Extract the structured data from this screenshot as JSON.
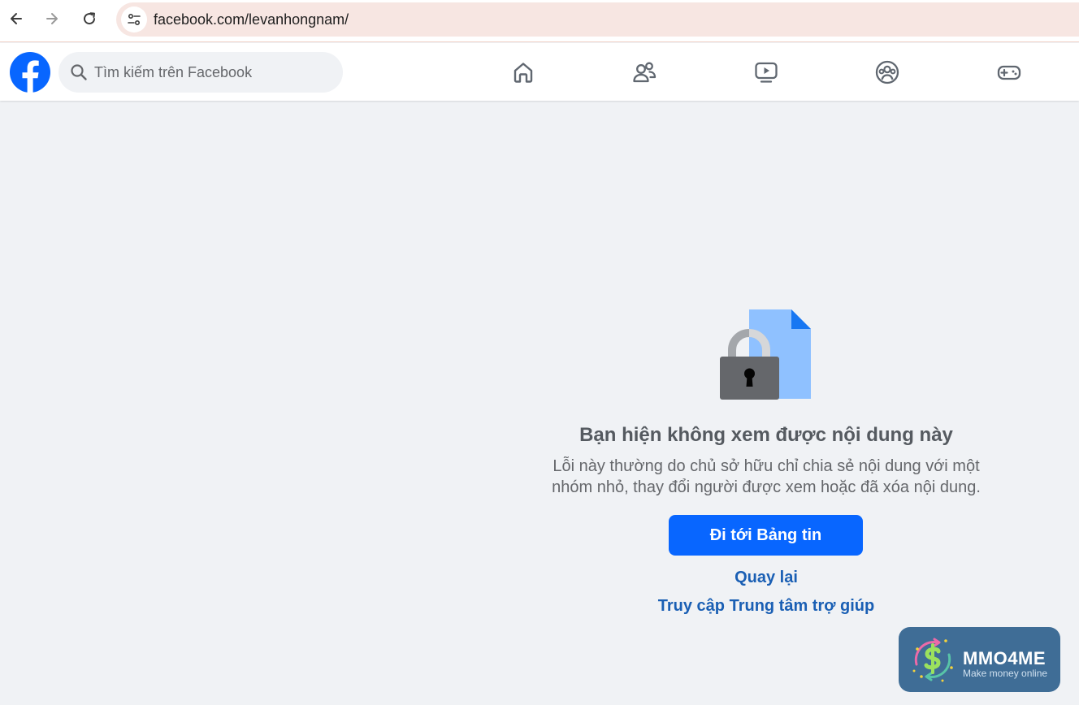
{
  "browser": {
    "url": "facebook.com/levanhongnam/"
  },
  "header": {
    "search_placeholder": "Tìm kiếm trên Facebook",
    "nav_icons": [
      "home-icon",
      "friends-icon",
      "video-icon",
      "groups-icon",
      "gaming-icon"
    ]
  },
  "error": {
    "title": "Bạn hiện không xem được nội dung này",
    "description_line1": "Lỗi này thường do chủ sở hữu chỉ chia sẻ nội dung với một",
    "description_line2": "nhóm nhỏ, thay đổi người được xem hoặc đã xóa nội dung.",
    "primary_button": "Đi tới Bảng tin",
    "back_link": "Quay lại",
    "help_link": "Truy cập Trung tâm trợ giúp"
  },
  "watermark": {
    "name": "MMO4ME",
    "tagline": "Make money online"
  },
  "colors": {
    "facebook_blue": "#0866ff",
    "link_blue": "#1a5fb4",
    "page_bg": "#f0f2f5",
    "omnibox_bg": "#f7e6e2"
  }
}
